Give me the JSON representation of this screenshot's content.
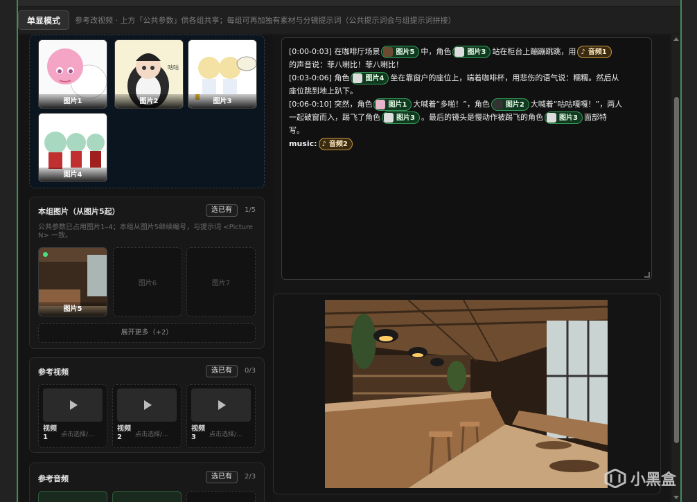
{
  "header": {
    "mode_button": "单显模式",
    "mode_hint": "参考改视频 · 上方「公共参数」供各组共享；每组可再加独有素材与分镜提示词（公共提示词会与组提示词拼接）"
  },
  "public_images": [
    {
      "label": "图片1"
    },
    {
      "label": "图片2"
    },
    {
      "label": "图片3"
    },
    {
      "label": "图片4"
    }
  ],
  "group_images": {
    "title": "本组图片（从图片5起）",
    "pick_label": "选已有",
    "count": "1/5",
    "description_line1": "公共参数已占用图片1–4；本组从图片5继续编号，与提示词 <Picture",
    "description_line2": "N> 一致。",
    "items": [
      {
        "label": "图片5",
        "filled": true
      },
      {
        "label": "图片6",
        "filled": false
      },
      {
        "label": "图片7",
        "filled": false
      }
    ],
    "expand_label": "展开更多（+2）"
  },
  "ref_video": {
    "title": "参考视频",
    "pick_label": "选已有",
    "count": "0/3",
    "items": [
      {
        "label": "视频 1",
        "hint": "点击选择/..."
      },
      {
        "label": "视频 2",
        "hint": "点击选择/..."
      },
      {
        "label": "视频 3",
        "hint": "点击选择/..."
      }
    ]
  },
  "ref_audio": {
    "title": "参考音频",
    "pick_label": "选已有",
    "count": "2/3"
  },
  "prompt": {
    "l1_a": "[0:00-0:03] 在咖啡厅场景",
    "l1_chip1": "图片5",
    "l1_b": "中，角色",
    "l1_chip2": "图片3",
    "l1_c": "站在柜台上蹦蹦跳跳，用",
    "l1_chip3": "音频1",
    "l2": "的声音说：菲八喇比！菲八喇比！",
    "l3_a": "[0:03-0:06] 角色",
    "l3_chip1": "图片4",
    "l3_b": "坐在靠窗户的座位上，端着咖啡杯，用悲伤的语气说：糯糯。然后从",
    "l4": "座位跳到地上趴下。",
    "l5_a": "[0:06-0:10] 突然，角色",
    "l5_chip1": "图片1",
    "l5_b": "大喊着“多啪！”，角色",
    "l5_chip2": "图片2",
    "l5_c": "大喊着“咕咕嘎嘎！”，两人",
    "l6_a": "一起破窗而入，踢飞了角色",
    "l6_chip1": "图片3",
    "l6_b": "。最后的镜头是慢动作被踢飞的角色",
    "l6_chip2": "图片3",
    "l6_c": "面部特",
    "l7": "写。",
    "l8_a": "music:",
    "l8_chip1": "音频2"
  },
  "watermark": "小黑盒",
  "colors": {
    "accent_green": "#3f8f55",
    "chip_image_border": "#35a05a",
    "chip_audio_border": "#c89a40"
  }
}
